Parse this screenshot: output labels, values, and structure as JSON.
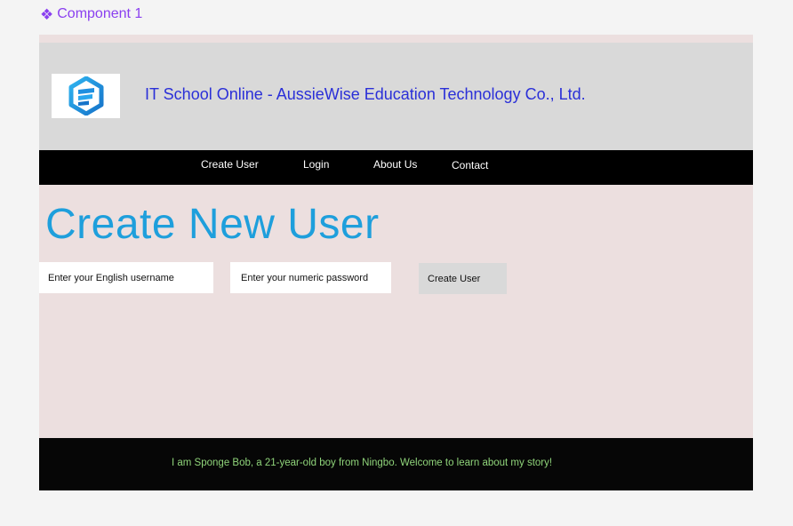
{
  "component_label": "Component 1",
  "header": {
    "logo_alt": "logo",
    "site_title": "IT School Online - AussieWise Education Technology Co., Ltd."
  },
  "nav": {
    "items": [
      {
        "label": "Create User"
      },
      {
        "label": "Login"
      },
      {
        "label": "About Us"
      },
      {
        "label": "Contact"
      }
    ]
  },
  "main": {
    "heading": "Create New User",
    "username_placeholder": "Enter your English username",
    "password_placeholder": "Enter your numeric password",
    "submit_label": "Create User"
  },
  "footer": {
    "text": "I am Sponge Bob, a 21-year-old boy from Ningbo. Welcome to learn about my story!"
  },
  "colors": {
    "accent_purple": "#8a3ff0",
    "title_blue": "#2a2fd8",
    "heading_blue": "#1e9fdc",
    "footer_green": "#8fd47a",
    "page_bg": "#ecdfdf",
    "header_bg": "#d9d9d9"
  }
}
